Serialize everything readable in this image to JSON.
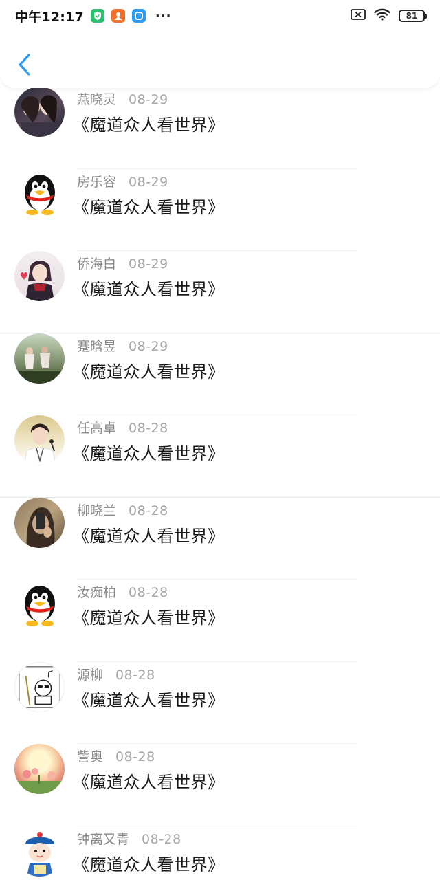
{
  "status_bar": {
    "time": "中午12:17",
    "battery": "81",
    "icons": [
      "shield-app-icon",
      "orange-app-icon",
      "blue-app-icon",
      "more-dots-icon",
      "sim-x-icon",
      "wifi-icon",
      "battery-icon"
    ],
    "dots": "···"
  },
  "header": {
    "back_icon": "chevron-left-icon"
  },
  "items": [
    {
      "name": "燕晓灵",
      "date": "08-29",
      "title": "《魔道众人看世界》",
      "avatar": "photo-two-girls"
    },
    {
      "name": "房乐容",
      "date": "08-29",
      "title": "《魔道众人看世界》",
      "avatar": "qq-penguin"
    },
    {
      "name": "侨海白",
      "date": "08-29",
      "title": "《魔道众人看世界》",
      "avatar": "anime-boy"
    },
    {
      "name": "蹇晗昱",
      "date": "08-29",
      "title": "《魔道众人看世界》",
      "avatar": "photo-field"
    },
    {
      "name": "任高卓",
      "date": "08-28",
      "title": "《魔道众人看世界》",
      "avatar": "photo-singer"
    },
    {
      "name": "柳晓兰",
      "date": "08-28",
      "title": "《魔道众人看世界》",
      "avatar": "photo-phone-selfie"
    },
    {
      "name": "汝痴柏",
      "date": "08-28",
      "title": "《魔道众人看世界》",
      "avatar": "qq-penguin"
    },
    {
      "name": "源柳",
      "date": "08-28",
      "title": "《魔道众人看世界》",
      "avatar": "sketch-cartoon"
    },
    {
      "name": "訾奥",
      "date": "08-28",
      "title": "《魔道众人看世界》",
      "avatar": "garden-painting"
    },
    {
      "name": "钟离又青",
      "date": "08-28",
      "title": "《魔道众人看世界》",
      "avatar": "qing-cartoon"
    }
  ],
  "colors": {
    "accent": "#2d9cf5",
    "name_text": "#8a8a8a",
    "date_text": "#a6a6a6"
  }
}
